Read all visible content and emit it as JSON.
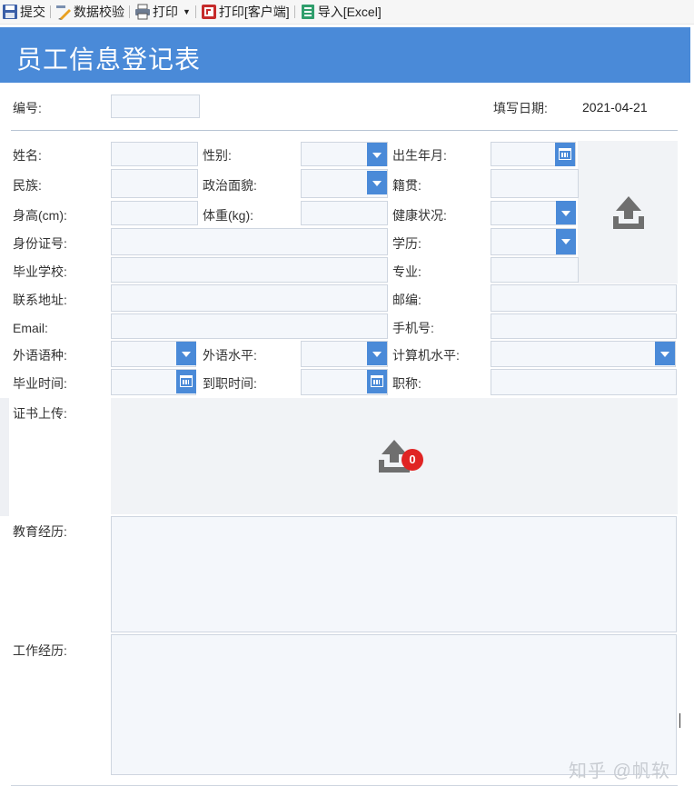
{
  "toolbar": {
    "submit": "提交",
    "validate": "数据校验",
    "print": "打印",
    "print_client": "打印[客户端]",
    "import_excel": "导入[Excel]"
  },
  "header": {
    "title": "员工信息登记表"
  },
  "form": {
    "number_label": "编号:",
    "fill_date_label": "填写日期:",
    "fill_date_value": "2021-04-21",
    "name_label": "姓名:",
    "gender_label": "性别:",
    "birth_label": "出生年月:",
    "ethnicity_label": "民族:",
    "politics_label": "政治面貌:",
    "native_label": "籍贯:",
    "height_label": "身高(cm):",
    "weight_label": "体重(kg):",
    "health_label": "健康状况:",
    "id_label": "身份证号:",
    "education_label": "学历:",
    "school_label": "毕业学校:",
    "major_label": "专业:",
    "address_label": "联系地址:",
    "postcode_label": "邮编:",
    "email_label": "Email:",
    "phone_label": "手机号:",
    "language_label": "外语语种:",
    "language_level_label": "外语水平:",
    "computer_level_label": "计算机水平:",
    "graduation_time_label": "毕业时间:",
    "onboard_time_label": "到职时间:",
    "title_label": "职称:",
    "certificate_label": "证书上传:",
    "certificate_count": "0",
    "edu_history_label": "教育经历:",
    "work_history_label": "工作经历:"
  },
  "watermark": "知乎 @帆软",
  "colors": {
    "header": "#4a8ad8",
    "field_bg": "#f4f7fb",
    "badge": "#e02424"
  },
  "icons": [
    "save-icon",
    "validate-icon",
    "print-icon",
    "print-client-icon",
    "excel-icon",
    "upload-icon",
    "calendar-icon",
    "dropdown-icon"
  ]
}
